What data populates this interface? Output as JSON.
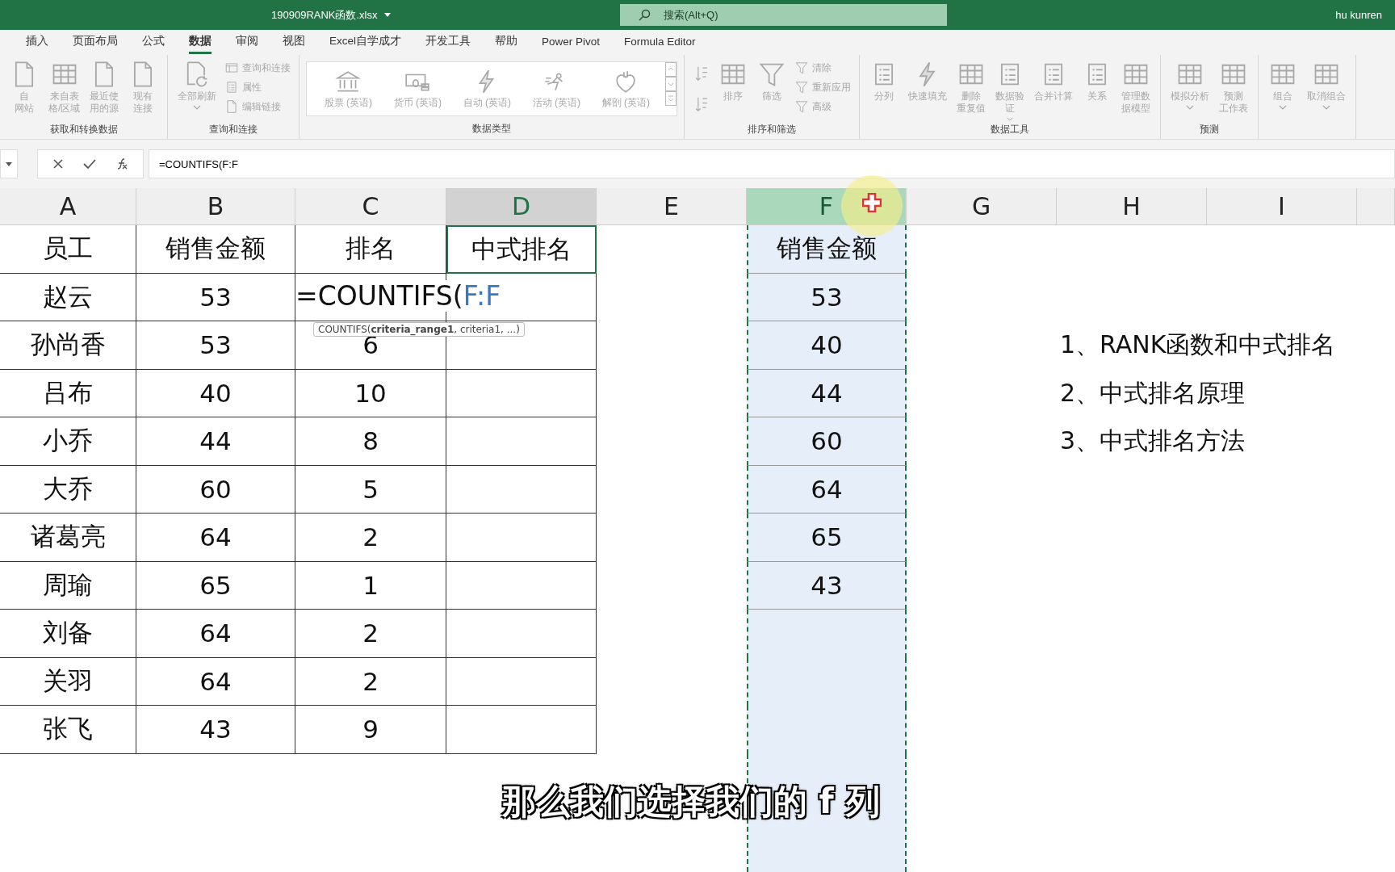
{
  "title_bar": {
    "file_name": "190909RANK函数.xlsx",
    "search": {
      "placeholder": "搜索(Alt+Q)"
    },
    "user": "hu kunren"
  },
  "tabs": [
    {
      "label": "插入",
      "selected": false
    },
    {
      "label": "页面布局",
      "selected": false
    },
    {
      "label": "公式",
      "selected": false
    },
    {
      "label": "数据",
      "selected": true
    },
    {
      "label": "审阅",
      "selected": false
    },
    {
      "label": "视图",
      "selected": false
    },
    {
      "label": "Excel自学成才",
      "selected": false
    },
    {
      "label": "开发工具",
      "selected": false
    },
    {
      "label": "帮助",
      "selected": false
    },
    {
      "label": "Power Pivot",
      "selected": false
    },
    {
      "label": "Formula Editor",
      "selected": false
    }
  ],
  "ribbon": {
    "disabled": true,
    "groups": [
      {
        "label": "获取和转换数据",
        "kind": "buttons",
        "items": [
          {
            "kind": "large",
            "lines": [
              "自",
              "网站"
            ]
          },
          {
            "kind": "large",
            "lines": [
              "来自表",
              "格/区域"
            ]
          },
          {
            "kind": "large",
            "lines": [
              "最近使",
              "用的源"
            ]
          },
          {
            "kind": "large",
            "lines": [
              "现有",
              "连接"
            ]
          }
        ]
      },
      {
        "label": "查询和连接",
        "kind": "buttons",
        "items": [
          {
            "kind": "large",
            "label": "全部刷新",
            "menu": true
          },
          {
            "kind": "small",
            "label": "查询和连接"
          },
          {
            "kind": "small",
            "label": "属性"
          },
          {
            "kind": "small",
            "label": "编辑链接"
          }
        ]
      },
      {
        "label": "数据类型",
        "kind": "gallery",
        "items": [
          {
            "kind": "large",
            "label": "股票 (英语)"
          },
          {
            "kind": "large",
            "label": "货币 (英语)"
          },
          {
            "kind": "large",
            "label": "自动 (英语)"
          },
          {
            "kind": "large",
            "label": "活动 (英语)"
          },
          {
            "kind": "large",
            "label": "解剖 (英语)"
          }
        ]
      },
      {
        "label": "排序和筛选",
        "kind": "buttons",
        "items": [
          {
            "kind": "tiny"
          },
          {
            "kind": "tiny"
          },
          {
            "kind": "large",
            "label": "排序"
          },
          {
            "kind": "large",
            "label": "筛选"
          },
          {
            "kind": "small",
            "label": "清除"
          },
          {
            "kind": "small",
            "label": "重新应用"
          },
          {
            "kind": "small",
            "label": "高级"
          }
        ]
      },
      {
        "label": "数据工具",
        "kind": "buttons",
        "items": [
          {
            "kind": "large",
            "label": "分列"
          },
          {
            "kind": "large",
            "label": "快速填充"
          },
          {
            "kind": "large",
            "lines": [
              "删除",
              "重复值"
            ]
          },
          {
            "kind": "large",
            "lines": [
              "数据验",
              "证"
            ],
            "menu": true
          },
          {
            "kind": "large",
            "label": "合并计算"
          },
          {
            "kind": "large",
            "label": "关系"
          },
          {
            "kind": "large",
            "lines": [
              "管理数",
              "据模型"
            ]
          }
        ]
      },
      {
        "label": "预测",
        "kind": "buttons",
        "items": [
          {
            "kind": "large",
            "label": "模拟分析",
            "menu": true
          },
          {
            "kind": "large",
            "lines": [
              "预测",
              "工作表"
            ]
          }
        ]
      },
      {
        "kind": "buttons",
        "items": [
          {
            "kind": "large",
            "label": "组合",
            "menu": true
          },
          {
            "kind": "large",
            "label": "取消组合",
            "menu": true
          }
        ]
      }
    ]
  },
  "formula_bar": {
    "formula": "=COUNTIFS(F:F"
  },
  "sheet": {
    "columns": [
      {
        "label": "A",
        "selected": false,
        "highlighted": false
      },
      {
        "label": "B",
        "selected": false,
        "highlighted": false
      },
      {
        "label": "C",
        "selected": false,
        "highlighted": false
      },
      {
        "label": "D",
        "selected": false,
        "highlighted": true
      },
      {
        "label": "E",
        "selected": false,
        "highlighted": false
      },
      {
        "label": "F",
        "selected": true,
        "highlighted": false
      },
      {
        "label": "G",
        "selected": false,
        "highlighted": false
      },
      {
        "label": "H",
        "selected": false,
        "highlighted": false
      },
      {
        "label": "I",
        "selected": false,
        "highlighted": false
      }
    ],
    "rows": [
      {
        "employee": "员工",
        "sales": "销售金额",
        "rank": "排名",
        "cn_rank": "中式排名",
        "f": "销售金额"
      },
      {
        "employee": "赵云",
        "sales": "53",
        "editing": {
          "function": "=COUNTIFS(",
          "reference": "F:F"
        },
        "f": "53"
      },
      {
        "employee": "孙尚香",
        "sales": "53",
        "rank": "6",
        "f": "40",
        "note": "1、RANK函数和中式排名"
      },
      {
        "employee": "吕布",
        "sales": "40",
        "rank": "10",
        "f": "44",
        "note": "2、中式排名原理"
      },
      {
        "employee": "小乔",
        "sales": "44",
        "rank": "8",
        "f": "60",
        "note": "3、中式排名方法"
      },
      {
        "employee": "大乔",
        "sales": "60",
        "rank": "5",
        "f": "64"
      },
      {
        "employee": "诸葛亮",
        "sales": "64",
        "rank": "2",
        "f": "65"
      },
      {
        "employee": "周瑜",
        "sales": "65",
        "rank": "1",
        "f": "43"
      },
      {
        "employee": "刘备",
        "sales": "64",
        "rank": "2"
      },
      {
        "employee": "关羽",
        "sales": "64",
        "rank": "2"
      },
      {
        "employee": "张飞",
        "sales": "43",
        "rank": "9"
      }
    ],
    "tooltip": "COUNTIFS(**criteria_range1**, criteria1, ...)"
  },
  "caption": "那么我们选择我们的 f 列"
}
